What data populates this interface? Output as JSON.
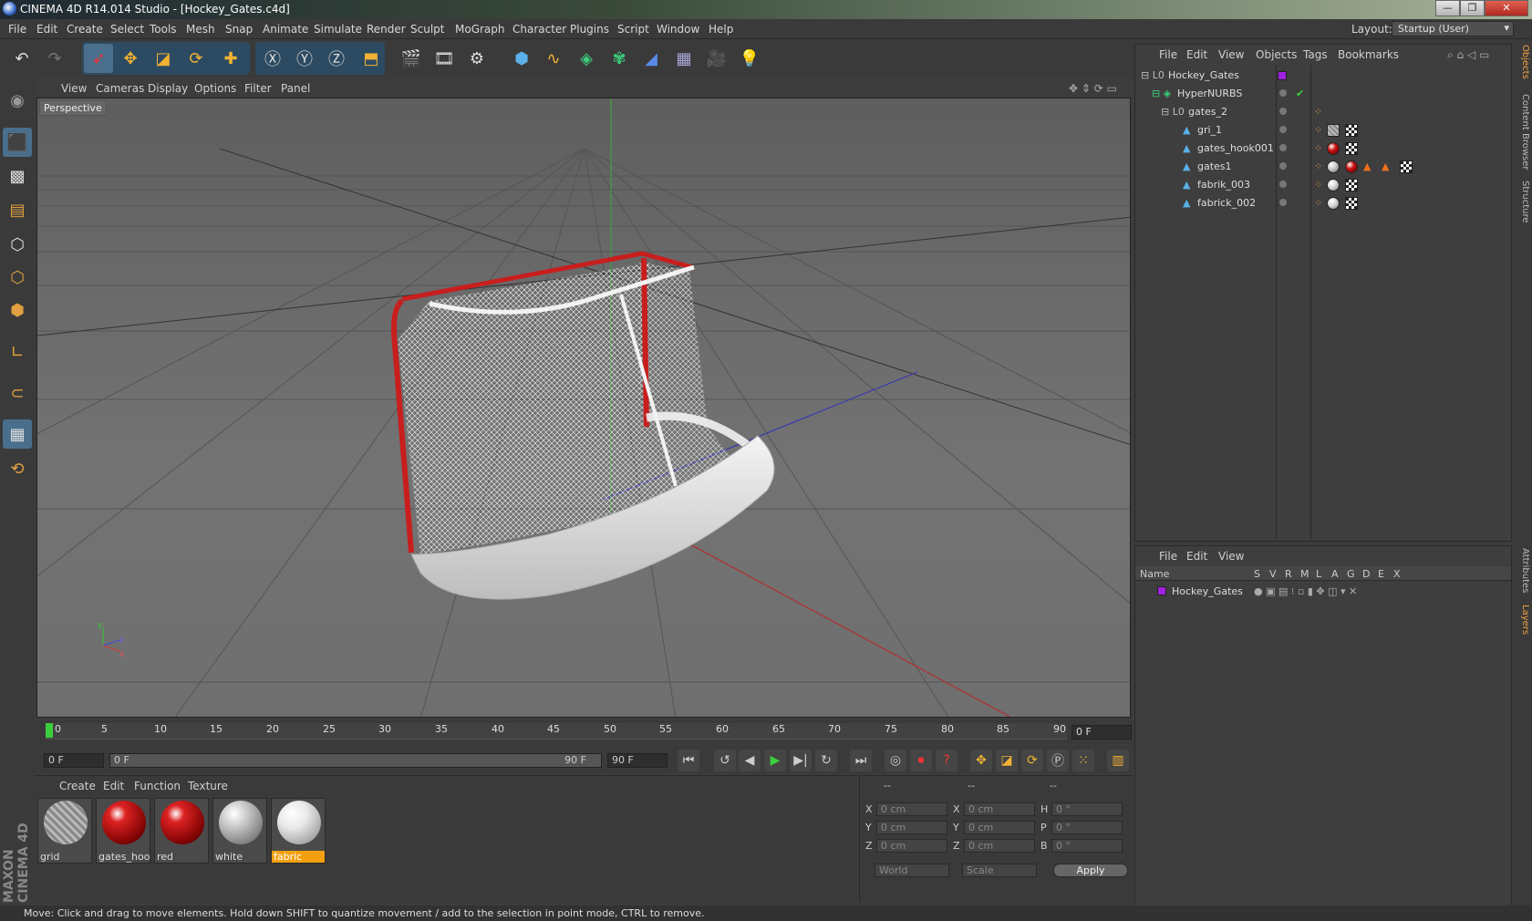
{
  "window": {
    "title": "CINEMA 4D R14.014 Studio - [Hockey_Gates.c4d]",
    "controls": [
      "—",
      "❐",
      "✕"
    ]
  },
  "menubar": {
    "items": [
      "File",
      "Edit",
      "Create",
      "Select",
      "Tools",
      "Mesh",
      "Snap",
      "Animate",
      "Simulate",
      "Render",
      "Sculpt",
      "MoGraph",
      "Character",
      "Plugins",
      "Script",
      "Window",
      "Help"
    ],
    "layout_label": "Layout:",
    "layout_value": "Startup (User)"
  },
  "viewport": {
    "menu": [
      "View",
      "Cameras",
      "Display",
      "Options",
      "Filter",
      "Panel"
    ],
    "label": "Perspective"
  },
  "timeline": {
    "ticks": [
      "0",
      "5",
      "10",
      "15",
      "20",
      "25",
      "30",
      "35",
      "40",
      "45",
      "50",
      "55",
      "60",
      "65",
      "70",
      "75",
      "80",
      "85",
      "90"
    ],
    "current_frame": "0 F",
    "start_field": "0 F",
    "range_start": "0 F",
    "range_end": "90 F",
    "end_field": "90 F"
  },
  "materials": {
    "menu": [
      "Create",
      "Edit",
      "Function",
      "Texture"
    ],
    "items": [
      {
        "label": "grid",
        "kind": "grid"
      },
      {
        "label": "gates_hool",
        "kind": "red"
      },
      {
        "label": "red",
        "kind": "red"
      },
      {
        "label": "white",
        "kind": "white"
      },
      {
        "label": "fabric",
        "kind": "fabric",
        "selected": true
      }
    ]
  },
  "coordinates": {
    "headers": [
      "--",
      "--",
      "--"
    ],
    "rows": [
      {
        "a": "X",
        "av": "0 cm",
        "b": "X",
        "bv": "0 cm",
        "c": "H",
        "cv": "0 °"
      },
      {
        "a": "Y",
        "av": "0 cm",
        "b": "Y",
        "bv": "0 cm",
        "c": "P",
        "cv": "0 °"
      },
      {
        "a": "Z",
        "av": "0 cm",
        "b": "Z",
        "bv": "0 cm",
        "c": "B",
        "cv": "0 °"
      }
    ],
    "world": "World",
    "scale": "Scale",
    "apply": "Apply"
  },
  "objects": {
    "menu": [
      "File",
      "Edit",
      "View",
      "Objects",
      "Tags",
      "Bookmarks"
    ],
    "tree": [
      {
        "name": "Hockey_Gates",
        "depth": 0
      },
      {
        "name": "HyperNURBS",
        "depth": 1
      },
      {
        "name": "gates_2",
        "depth": 2
      },
      {
        "name": "gri_1",
        "depth": 3
      },
      {
        "name": "gates_hook001",
        "depth": 3
      },
      {
        "name": "gates1",
        "depth": 3
      },
      {
        "name": "fabrik_003",
        "depth": 3
      },
      {
        "name": "fabrick_002",
        "depth": 3
      }
    ]
  },
  "layers": {
    "menu": [
      "File",
      "Edit",
      "View"
    ],
    "columns": [
      "Name",
      "S",
      "V",
      "R",
      "M",
      "L",
      "A",
      "G",
      "D",
      "E",
      "X"
    ],
    "rows": [
      {
        "name": "Hockey_Gates"
      }
    ]
  },
  "sidetabs": [
    "Objects",
    "Content Browser",
    "Structure",
    "Attributes",
    "Layers"
  ],
  "brand": "MAXON CINEMA 4D",
  "status": "Move: Click and drag to move elements. Hold down SHIFT to quantize movement / add to the selection in point mode, CTRL to remove."
}
